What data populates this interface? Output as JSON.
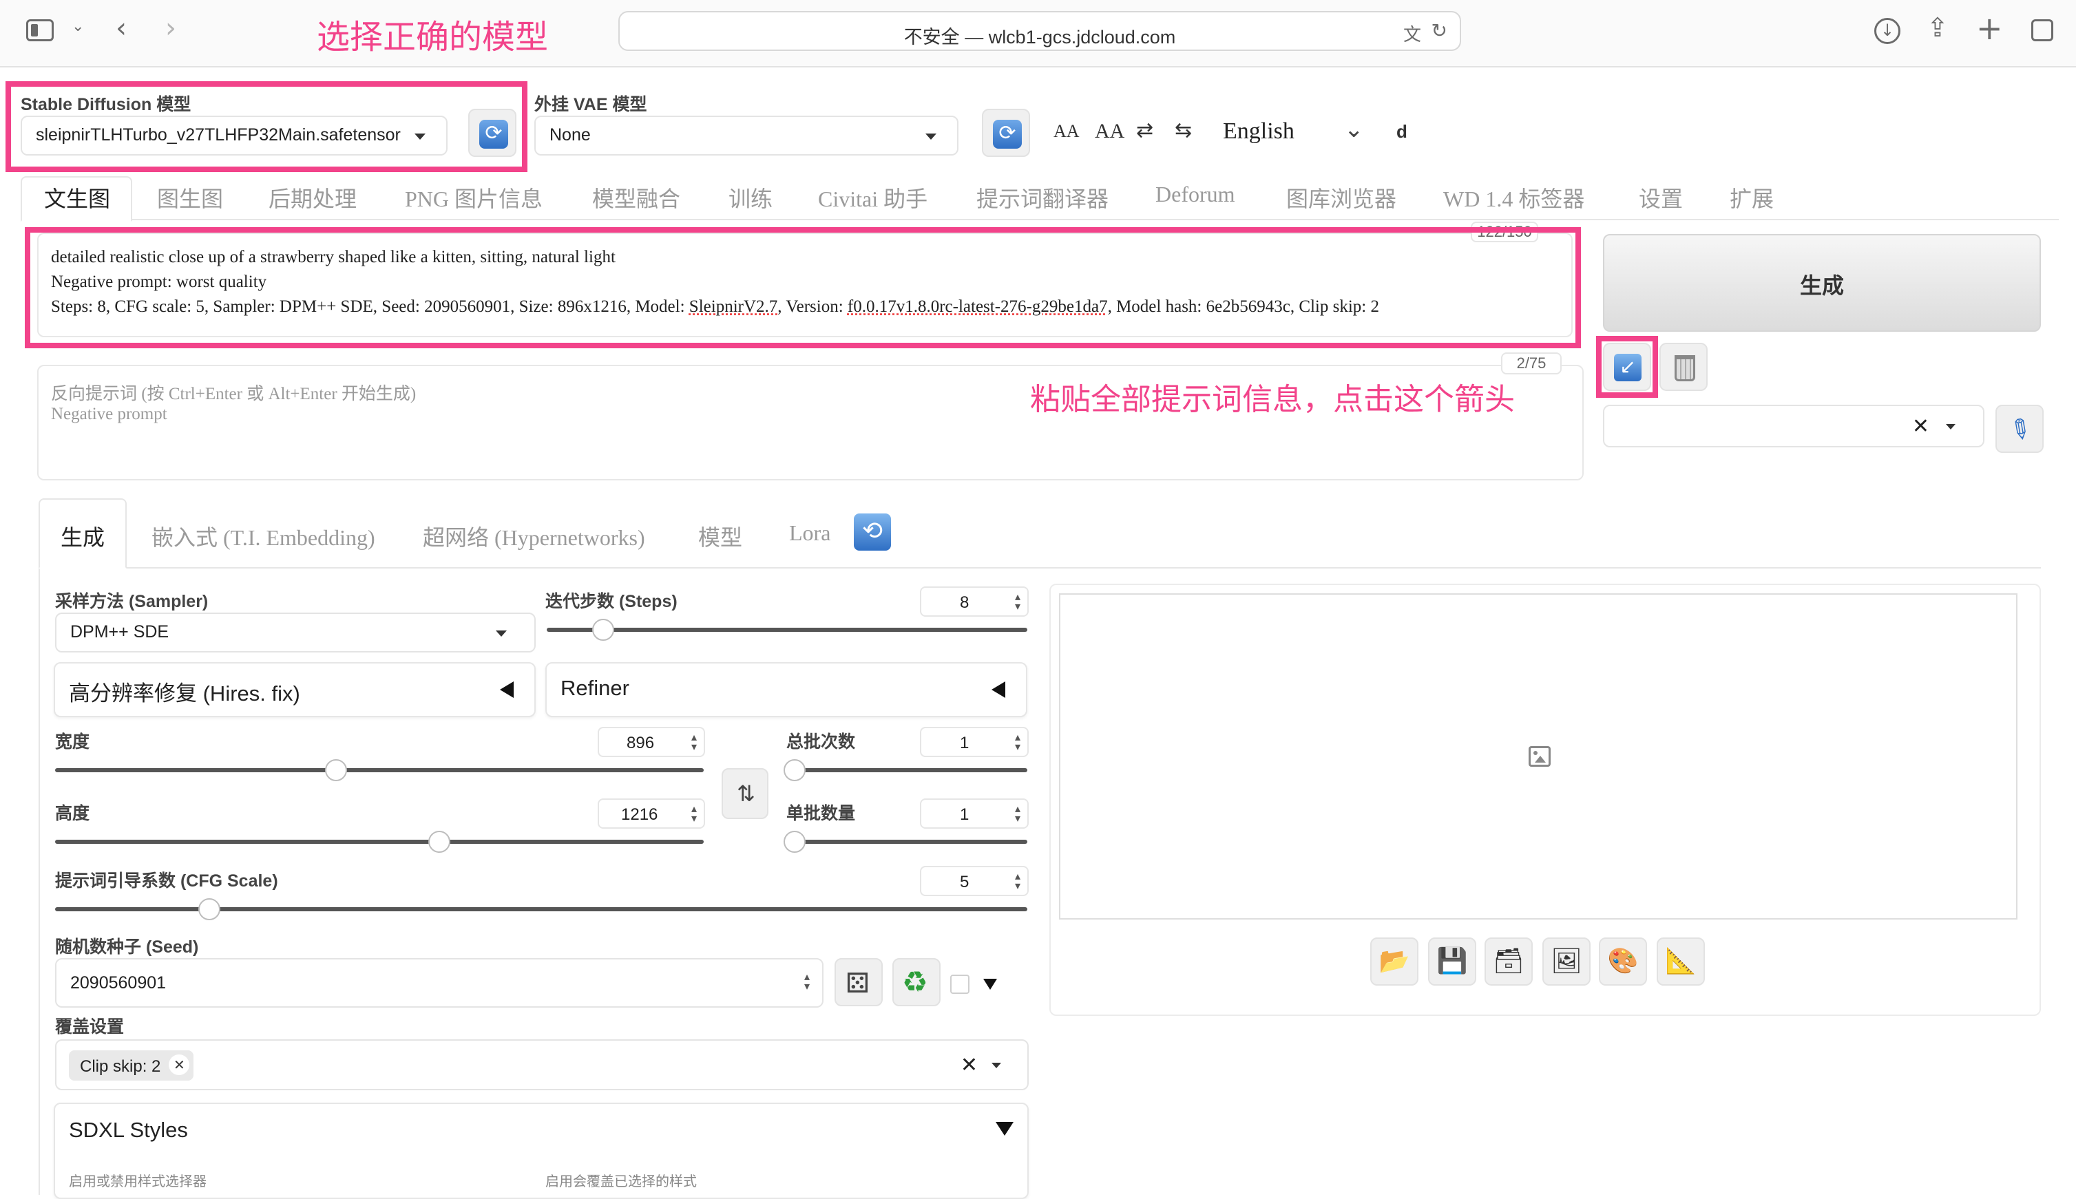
{
  "browser": {
    "url": "不安全 — wlcb1-gcs.jdcloud.com"
  },
  "annotations": {
    "select_model": "选择正确的模型",
    "paste_info": "粘贴全部提示词信息，点击这个箭头"
  },
  "model_bar": {
    "sd_label": "Stable Diffusion 模型",
    "sd_value": "sleipnirTLHTurbo_v27TLHFP32Main.safetensor",
    "vae_label": "外挂 VAE 模型",
    "vae_value": "None",
    "font_small": "AA",
    "font_large": "AA",
    "swap_glyph_1": "⇄",
    "swap_glyph_2": "⇆",
    "language": "English",
    "letter": "d"
  },
  "main_tabs": [
    "文生图",
    "图生图",
    "后期处理",
    "PNG 图片信息",
    "模型融合",
    "训练",
    "Civitai 助手",
    "提示词翻译器",
    "Deforum",
    "图库浏览器",
    "WD 1.4 标签器",
    "设置",
    "扩展"
  ],
  "prompt": {
    "counter": "122/150",
    "line1": "detailed realistic close up of a strawberry shaped like a kitten, sitting, natural light",
    "line2": "Negative prompt: worst quality",
    "line3_pre": "Steps: 8, CFG scale: 5, Sampler: DPM++ SDE, Seed: 2090560901, Size: 896x1216, Model: ",
    "model_link": "SleipnirV2.7",
    "line3_mid": ", Version: ",
    "version_link": "f0.0.17v1.8.0rc-latest-276-g29be1da7",
    "line3_post": ", Model hash: 6e2b56943c, Clip skip: 2"
  },
  "negative": {
    "counter": "2/75",
    "placeholder1": "反向提示词 (按 Ctrl+Enter 或 Alt+Enter 开始生成)",
    "placeholder2": "Negative prompt"
  },
  "generate_button": "生成",
  "styles_clear": "✕",
  "sub_tabs": [
    "生成",
    "嵌入式 (T.I. Embedding)",
    "超网络 (Hypernetworks)",
    "模型",
    "Lora"
  ],
  "params": {
    "sampler_label": "采样方法 (Sampler)",
    "sampler_value": "DPM++ SDE",
    "steps_label": "迭代步数 (Steps)",
    "steps_value": "8",
    "steps_fraction": 0.1,
    "hires_label": "高分辨率修复 (Hires. fix)",
    "refiner_label": "Refiner",
    "width_label": "宽度",
    "width_value": "896",
    "width_fraction": 0.42,
    "height_label": "高度",
    "height_value": "1216",
    "height_fraction": 0.58,
    "swap_glyph": "⇅",
    "batch_count_label": "总批次数",
    "batch_count_value": "1",
    "batch_count_fraction": 0.0,
    "batch_size_label": "单批数量",
    "batch_size_value": "1",
    "batch_size_fraction": 0.0,
    "cfg_label": "提示词引导系数 (CFG Scale)",
    "cfg_value": "5",
    "cfg_fraction": 0.15,
    "seed_label": "随机数种子 (Seed)",
    "seed_value": "2090560901",
    "override_label": "覆盖设置",
    "override_chip": "Clip skip: 2",
    "sdxl_label": "SDXL Styles",
    "sdxl_sub1": "启用或禁用样式选择器",
    "sdxl_sub2": "启用会覆盖已选择的样式"
  },
  "colors": {
    "annotation": "#f2438a",
    "refresh_blue": "#2f6fc4"
  }
}
